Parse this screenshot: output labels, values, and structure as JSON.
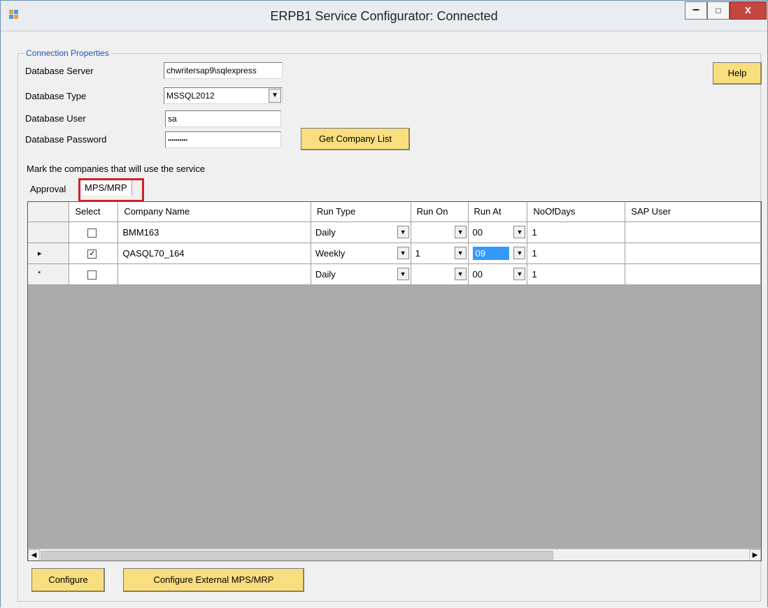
{
  "window": {
    "title": "ERPB1 Service Configurator: Connected",
    "minimize_glyph": "–",
    "maximize_glyph": "□",
    "close_glyph": "x"
  },
  "connection": {
    "group_label": "Connection Properties",
    "server_label": "Database Server",
    "server_value": "chwritersap9\\sqlexpress",
    "type_label": "Database Type",
    "type_value": "MSSQL2012",
    "user_label": "Database User",
    "user_value": "sa",
    "password_label": "Database Password",
    "password_value": "••••••••••",
    "get_company_list_label": "Get Company List",
    "help_label": "Help"
  },
  "instruction": "Mark the companies that will use the service",
  "tabs": [
    {
      "label": "Approval"
    },
    {
      "label": "MPS/MRP"
    }
  ],
  "grid": {
    "columns": [
      "Select",
      "Company Name",
      "Run Type",
      "Run On",
      "Run At",
      "NoOfDays",
      "SAP User"
    ],
    "rows": [
      {
        "indicator": "",
        "checked": false,
        "company": "BMM163",
        "run_type": "Daily",
        "run_on": "",
        "run_at": "00",
        "days": "1",
        "sap_user": ""
      },
      {
        "indicator": "▸",
        "checked": true,
        "company": "QASQL70_164",
        "run_type": "Weekly",
        "run_on": "1",
        "run_at": "09",
        "days": "1",
        "sap_user": ""
      },
      {
        "indicator": "*",
        "checked": false,
        "company": "",
        "run_type": "Daily",
        "run_on": "",
        "run_at": "00",
        "days": "1",
        "sap_user": ""
      }
    ]
  },
  "buttons": {
    "configure_label": "Configure",
    "configure_external_label": "Configure External MPS/MRP"
  },
  "colors": {
    "button_yellow": "#f8de7e",
    "tab_highlight": "#d22027",
    "selection_blue": "#3399ff",
    "legend_blue": "#2451b5"
  }
}
